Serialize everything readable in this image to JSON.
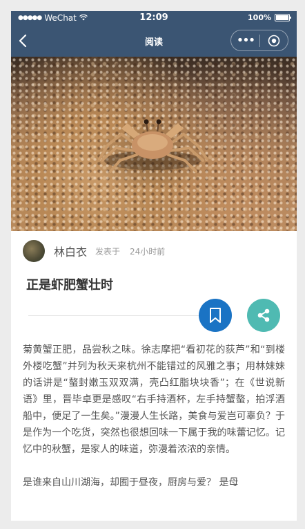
{
  "status_bar": {
    "signal": "●●●●●",
    "carrier": "WeChat",
    "time": "12:09",
    "battery": "100%"
  },
  "nav": {
    "title": "阅读",
    "more": "•••"
  },
  "article": {
    "author": "林白衣",
    "posted_label": "发表于",
    "time_ago": "24小时前",
    "title": "正是虾肥蟹壮时",
    "paragraphs": [
      "菊黄蟹正肥，品尝秋之味。徐志摩把“看初花的荻芦”和“到楼外楼吃蟹”并列为秋天来杭州不能错过的风雅之事；用林妹妹的话讲是“螯封嫩玉双双满，壳凸红脂块块香”；在《世说新语》里，晋毕卓更是感叹“右手持酒杯，左手持蟹螯，拍浮酒船中，便足了一生矣。”漫漫人生长路，美食与爱岂可辜负？于是作为一个吃货，突然也很想回味一下属于我的味蕾记忆。记忆中的秋蟹，是家人的味道，弥漫着浓浓的亲情。",
      "是谁来自山川湖海，却囿于昼夜，厨房与爱？ 是母"
    ]
  },
  "colors": {
    "nav_bg": "#3b5573",
    "bookmark_bg": "#1a73c4",
    "share_bg": "#4fbab2"
  },
  "icons": {
    "back": "chevron-left-icon",
    "close": "target-circle-icon",
    "bookmark": "bookmark-icon",
    "share": "share-icon"
  }
}
